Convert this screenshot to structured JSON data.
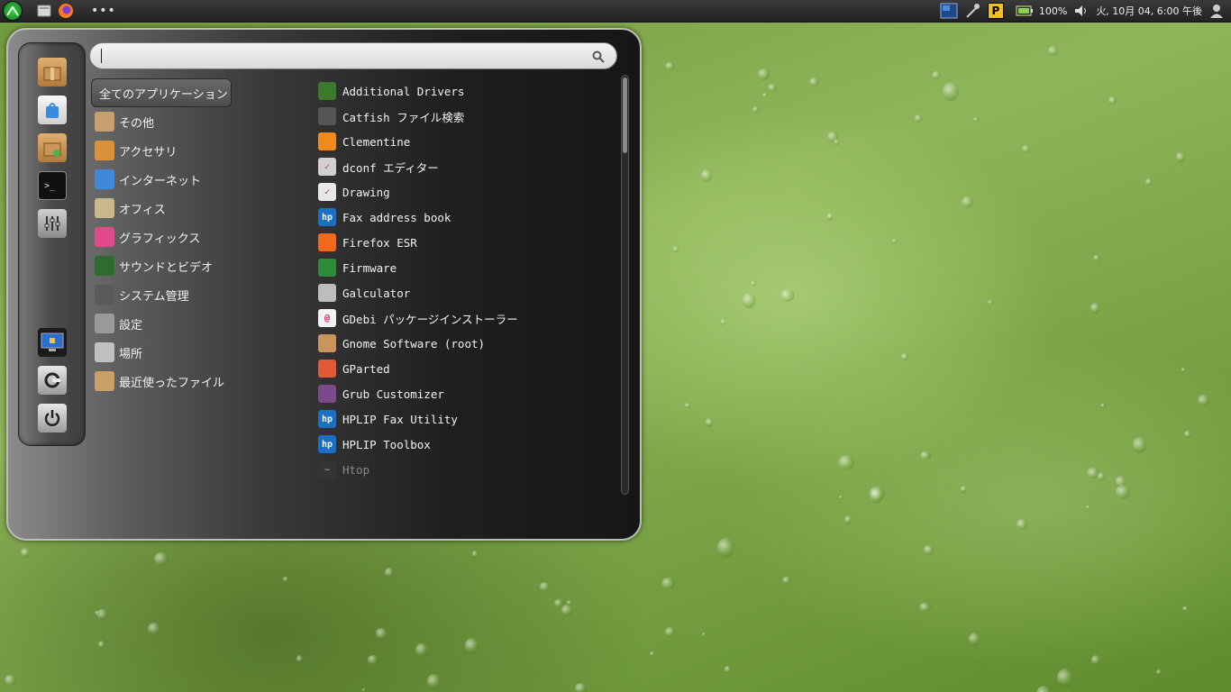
{
  "top_panel": {
    "battery": "100%",
    "clock": "火, 10月 04,  6:00 午後",
    "tray_dots": "•••",
    "tray_letter": "P"
  },
  "search": {
    "placeholder": "",
    "value": ""
  },
  "categories": [
    {
      "label": "全てのアプリケーション",
      "color": "#00000000"
    },
    {
      "label": "その他",
      "color": "#c8a070"
    },
    {
      "label": "アクセサリ",
      "color": "#d9923a"
    },
    {
      "label": "インターネット",
      "color": "#3f8ad8"
    },
    {
      "label": "オフィス",
      "color": "#c9b98a"
    },
    {
      "label": "グラフィックス",
      "color": "#e04a8a"
    },
    {
      "label": "サウンドとビデオ",
      "color": "#2f6b2f"
    },
    {
      "label": "システム管理",
      "color": "#5a5a5a"
    },
    {
      "label": "設定",
      "color": "#9a9a9a"
    },
    {
      "label": "場所",
      "color": "#c0c0c0"
    },
    {
      "label": "最近使ったファイル",
      "color": "#caa066"
    }
  ],
  "apps": [
    {
      "label": "Additional Drivers",
      "color": "#3a7a2a",
      "glyph": ""
    },
    {
      "label": "Catfish ファイル検索",
      "color": "#555555",
      "glyph": ""
    },
    {
      "label": "Clementine",
      "color": "#f28a1a",
      "glyph": ""
    },
    {
      "label": "dconf エディター",
      "color": "#d0d0d0",
      "glyph": "✓"
    },
    {
      "label": "Drawing",
      "color": "#e8e8e8",
      "glyph": "✓"
    },
    {
      "label": "Fax address book",
      "color": "#1a6fc4",
      "glyph": "hp"
    },
    {
      "label": "Firefox ESR",
      "color": "#f06a1a",
      "glyph": ""
    },
    {
      "label": "Firmware",
      "color": "#2f8a3a",
      "glyph": ""
    },
    {
      "label": "Galculator",
      "color": "#bdbdbd",
      "glyph": ""
    },
    {
      "label": "GDebi パッケージインストーラー",
      "color": "#f2f2f2",
      "glyph": "@"
    },
    {
      "label": "Gnome Software (root)",
      "color": "#c8955a",
      "glyph": ""
    },
    {
      "label": "GParted",
      "color": "#e05a3a",
      "glyph": ""
    },
    {
      "label": "Grub Customizer",
      "color": "#7a4a8a",
      "glyph": ""
    },
    {
      "label": "HPLIP Fax Utility",
      "color": "#1a6fc4",
      "glyph": "hp"
    },
    {
      "label": "HPLIP Toolbox",
      "color": "#1a6fc4",
      "glyph": "hp"
    },
    {
      "label": "Htop",
      "color": "#3a3a3a",
      "glyph": "~"
    }
  ]
}
